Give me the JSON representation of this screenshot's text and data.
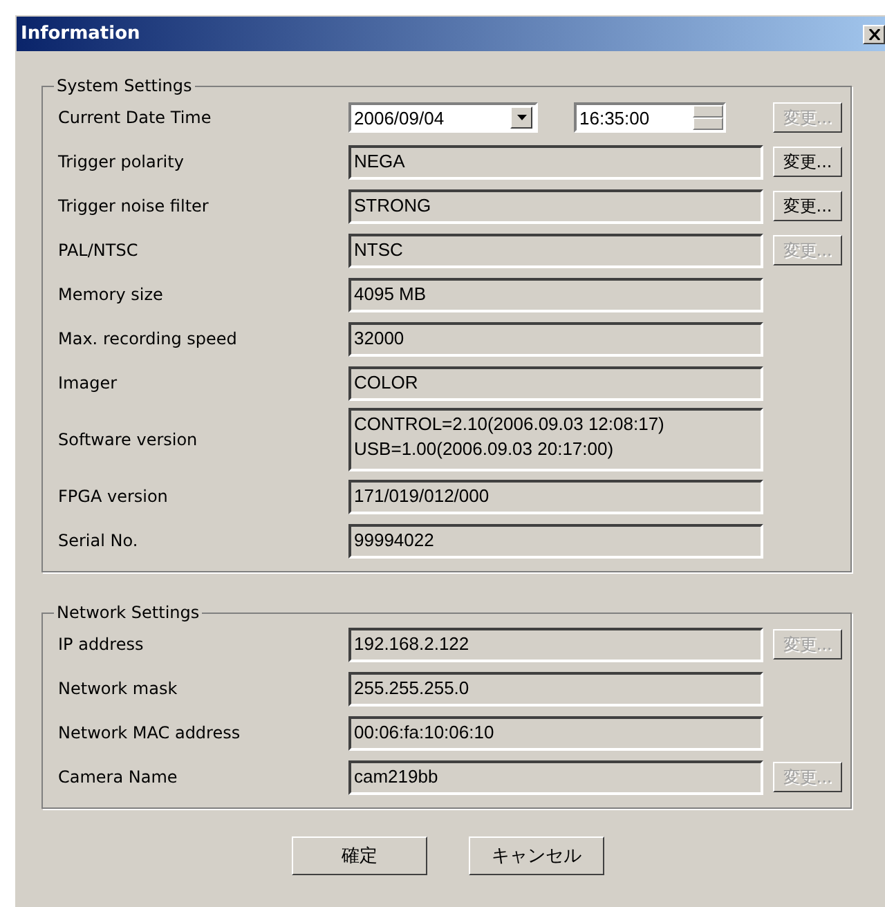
{
  "window": {
    "title": "Information"
  },
  "groups": [
    {
      "title": "System Settings",
      "rows": [
        {
          "label": "Current Date Time",
          "kind": "datetime",
          "date": "2006/09/04",
          "time": "16:35:00",
          "button": {
            "label": "変更...",
            "disabled": true
          }
        },
        {
          "label": "Trigger polarity",
          "kind": "text",
          "lines": [
            "NEGA"
          ],
          "button": {
            "label": "変更...",
            "disabled": false
          }
        },
        {
          "label": "Trigger noise filter",
          "kind": "text",
          "lines": [
            "STRONG"
          ],
          "button": {
            "label": "変更...",
            "disabled": false
          }
        },
        {
          "label": "PAL/NTSC",
          "kind": "text",
          "lines": [
            "NTSC"
          ],
          "button": {
            "label": "変更...",
            "disabled": true
          }
        },
        {
          "label": "Memory size",
          "kind": "text",
          "lines": [
            "4095 MB"
          ]
        },
        {
          "label": "Max. recording speed",
          "kind": "text",
          "lines": [
            "32000"
          ]
        },
        {
          "label": "Imager",
          "kind": "text",
          "lines": [
            "COLOR"
          ]
        },
        {
          "label": "Software version",
          "kind": "text",
          "lines": [
            "CONTROL=2.10(2006.09.03 12:08:17)",
            "USB=1.00(2006.09.03 20:17:00)"
          ]
        },
        {
          "label": "FPGA version",
          "kind": "text",
          "lines": [
            "171/019/012/000"
          ]
        },
        {
          "label": "Serial No.",
          "kind": "text",
          "lines": [
            "99994022"
          ]
        }
      ]
    },
    {
      "title": "Network Settings",
      "rows": [
        {
          "label": "IP address",
          "kind": "text",
          "lines": [
            "192.168.2.122"
          ],
          "button": {
            "label": "変更...",
            "disabled": true
          }
        },
        {
          "label": "Network mask",
          "kind": "text",
          "lines": [
            "255.255.255.0"
          ]
        },
        {
          "label": "Network MAC address",
          "kind": "text",
          "lines": [
            "00:06:fa:10:06:10"
          ]
        },
        {
          "label": "Camera Name",
          "kind": "text",
          "lines": [
            "cam219bb"
          ],
          "button": {
            "label": "変更...",
            "disabled": true
          }
        }
      ]
    }
  ],
  "buttons": [
    "確定",
    "キャンセル"
  ]
}
